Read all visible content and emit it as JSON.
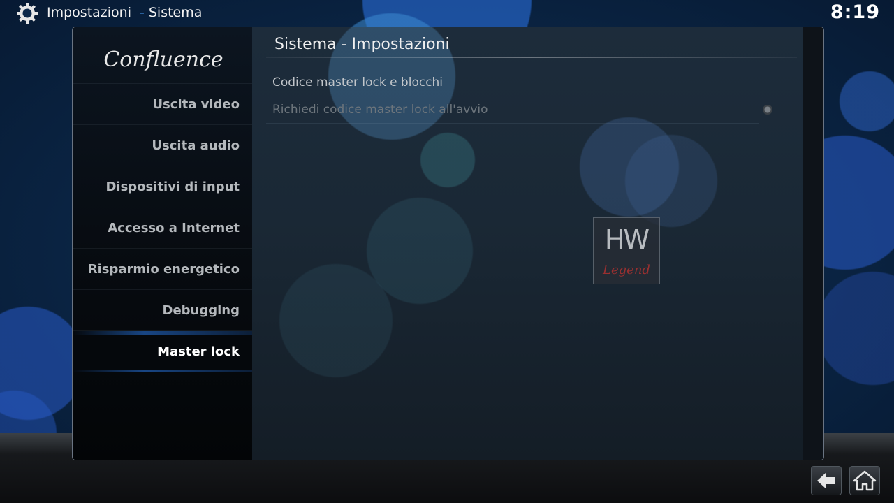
{
  "header": {
    "section": "Impostazioni",
    "separator": "-",
    "subsection": "Sistema",
    "clock": "8:19"
  },
  "logo_text": "Confluence",
  "sidebar": {
    "items": [
      {
        "label": "Uscita video",
        "active": false
      },
      {
        "label": "Uscita audio",
        "active": false
      },
      {
        "label": "Dispositivi di input",
        "active": false
      },
      {
        "label": "Accesso a Internet",
        "active": false
      },
      {
        "label": "Risparmio energetico",
        "active": false
      },
      {
        "label": "Debugging",
        "active": false
      },
      {
        "label": "Master lock",
        "active": true
      }
    ]
  },
  "main": {
    "title": "Sistema - Impostazioni",
    "settings": [
      {
        "label": "Codice master lock e blocchi",
        "enabled": true
      },
      {
        "label": "Richiedi codice master lock all'avvio",
        "enabled": false,
        "control": "radio-off"
      }
    ],
    "close_label": "×"
  },
  "watermark_text": "HW Legend",
  "icons": {
    "gear": "gear-icon",
    "close": "close-icon",
    "back": "back-arrow-icon",
    "home": "home-icon"
  },
  "colors": {
    "accent": "#2b7ce6",
    "crumb_separator": "#4aa3ff"
  }
}
